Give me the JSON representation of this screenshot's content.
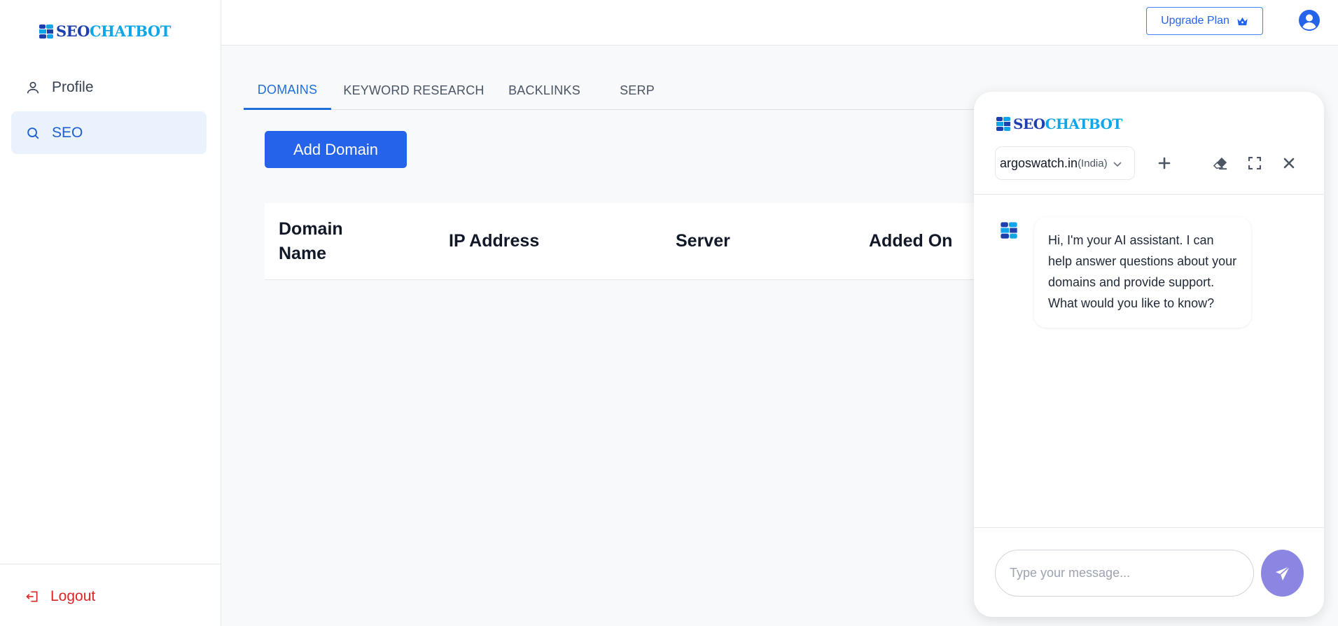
{
  "brand": {
    "part1": "SEO",
    "part2": "CHATBOT"
  },
  "sidebar": {
    "items": [
      {
        "label": "Profile",
        "icon": "user-icon"
      },
      {
        "label": "SEO",
        "icon": "search-icon",
        "active": true
      }
    ],
    "logout_label": "Logout"
  },
  "header": {
    "upgrade_label": "Upgrade Plan",
    "upgrade_icon": "crown-icon",
    "avatar_icon": "user-circle-icon"
  },
  "tabs": [
    {
      "label": "DOMAINS",
      "active": true
    },
    {
      "label": "KEYWORD RESEARCH"
    },
    {
      "label": "BACKLINKS"
    },
    {
      "label": "SERP"
    }
  ],
  "main": {
    "add_domain_label": "Add Domain",
    "table": {
      "columns": [
        "Domain\nName",
        "IP Address",
        "Server",
        "Added On"
      ],
      "rows": []
    }
  },
  "chat": {
    "domain": "argoswatch.in",
    "country": "(India)",
    "messages": [
      {
        "from": "bot",
        "text": "Hi, I'm your AI assistant. I can help answer questions about your domains and provide support. What would you like to know?"
      }
    ],
    "input_placeholder": "Type your message...",
    "input_value": ""
  },
  "colors": {
    "primary": "#2563eb",
    "active_bg": "#eaf2fd",
    "logout": "#dc2626",
    "send": "#8b86e2",
    "brand_dark": "#1e40af",
    "brand_light": "#0ea5e9"
  }
}
